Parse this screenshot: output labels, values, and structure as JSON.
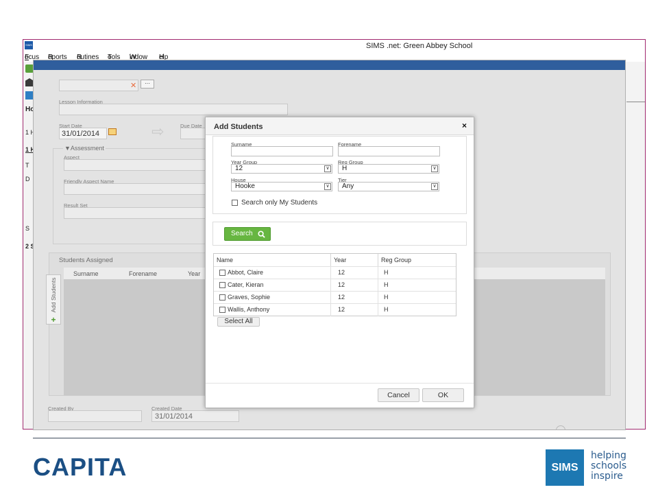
{
  "app": {
    "logo_text": "SIMS",
    "window_title": "SIMS .net: Green Abbey School",
    "menu": [
      {
        "first": "F",
        "rest": "ocus"
      },
      {
        "first": "R",
        "rest": "eports"
      },
      {
        "first": "R",
        "rest": "outines"
      },
      {
        "first": "T",
        "rest": "ools"
      },
      {
        "first": "W",
        "rest": "indow"
      },
      {
        "first": "H",
        "rest": "elp"
      }
    ],
    "left_labels": [
      "Ho",
      "1 H",
      "1 H",
      "T",
      "D",
      "S",
      "2 S"
    ]
  },
  "form": {
    "lesson_information_label": "Lesson Information",
    "start_date_label": "Start Date",
    "start_date_value": "31/01/2014",
    "due_date_label": "Due Date",
    "assessment_legend": "▼Assessment",
    "aspect_label": "Aspect",
    "friendly_aspect_label": "Friendly Aspect Name",
    "result_set_label": "Result Set",
    "students_assigned_label": "Students Assigned",
    "columns": [
      "Surname",
      "Forename",
      "Year"
    ],
    "add_students_tab": "Add Students",
    "created_by_label": "Created By",
    "created_date_label": "Created Date",
    "created_date_value": "31/01/2014"
  },
  "dialog": {
    "title": "Add Students",
    "close_glyph": "×",
    "surname_label": "Surname",
    "surname_value": "",
    "forename_label": "Forename",
    "forename_value": "",
    "year_group_label": "Year Group",
    "year_group_value": "12",
    "reg_group_label": "Reg Group",
    "reg_group_value": "H",
    "house_label": "House",
    "house_value": "Hooke",
    "tier_label": "Tier",
    "tier_value": "Any",
    "only_my_students_label": "Search only My Students",
    "search_label": "Search",
    "results_headers": [
      "Name",
      "Year",
      "Reg Group"
    ],
    "results": [
      {
        "name": "Abbot, Claire",
        "year": "12",
        "reg": "H"
      },
      {
        "name": "Cater, Kieran",
        "year": "12",
        "reg": "H"
      },
      {
        "name": "Graves, Sophie",
        "year": "12",
        "reg": "H"
      },
      {
        "name": "Wallis, Anthony",
        "year": "12",
        "reg": "H"
      }
    ],
    "select_all_label": "Select All",
    "cancel_label": "Cancel",
    "ok_label": "OK"
  },
  "footer": {
    "brand": "CAPITA",
    "sims_logo": "SIMS",
    "tagline": [
      "helping",
      "schools",
      "inspire"
    ]
  },
  "colors": {
    "accent_green": "#67b641",
    "brand_blue": "#1b4f84",
    "window_border": "#a0286e",
    "inner_bar": "#2f5e9d"
  }
}
